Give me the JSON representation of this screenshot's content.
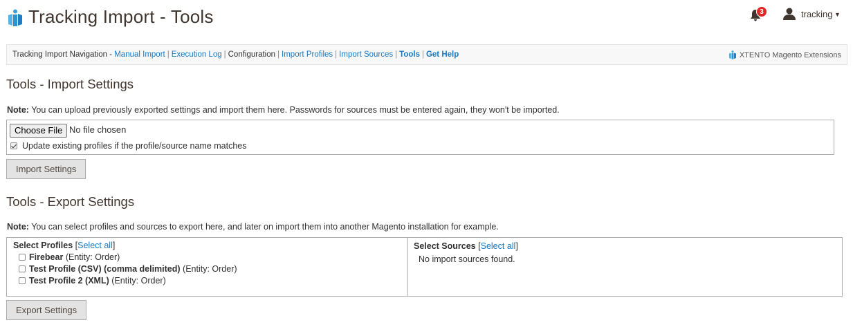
{
  "header": {
    "title": "Tracking Import - Tools",
    "notifications_count": "3",
    "user_name": "tracking"
  },
  "nav": {
    "prefix": "Tracking Import Navigation -",
    "items": [
      {
        "label": "Manual Import"
      },
      {
        "label": "Execution Log"
      },
      {
        "label": "Configuration"
      },
      {
        "label": "Import Profiles"
      },
      {
        "label": "Import Sources"
      },
      {
        "label": "Tools"
      },
      {
        "label": "Get Help"
      }
    ],
    "brand": "XTENTO Magento Extensions"
  },
  "import_section": {
    "title": "Tools - Import Settings",
    "note_label": "Note:",
    "note_text": " You can upload previously exported settings and import them here. Passwords for sources must be entered again, they won't be imported.",
    "choose_file_label": "Choose File",
    "no_file_text": "No file chosen",
    "update_checkbox_label": "Update existing profiles if the profile/source name matches",
    "update_checked": true,
    "button_label": "Import Settings"
  },
  "export_section": {
    "title": "Tools - Export Settings",
    "note_label": "Note:",
    "note_text": " You can select profiles and sources to export here, and later on import them into another Magento installation for example.",
    "profiles_heading": "Select Profiles",
    "sources_heading": "Select Sources",
    "select_all_label": "Select all",
    "profiles": [
      {
        "name": "Firebear",
        "entity": "(Entity: Order)"
      },
      {
        "name": "Test Profile (CSV) (comma delimited)",
        "entity": "(Entity: Order)"
      },
      {
        "name": "Test Profile 2 (XML)",
        "entity": "(Entity: Order)"
      }
    ],
    "no_sources_text": "No import sources found.",
    "button_label": "Export Settings"
  },
  "colors": {
    "link": "#1979c3",
    "heading": "#41362f",
    "badge": "#e22626",
    "button_bg": "#e3e3e3"
  },
  "icons": [
    "xtento-logo-icon",
    "bell-icon",
    "user-icon",
    "caret-down-icon",
    "checkbox-icon"
  ]
}
